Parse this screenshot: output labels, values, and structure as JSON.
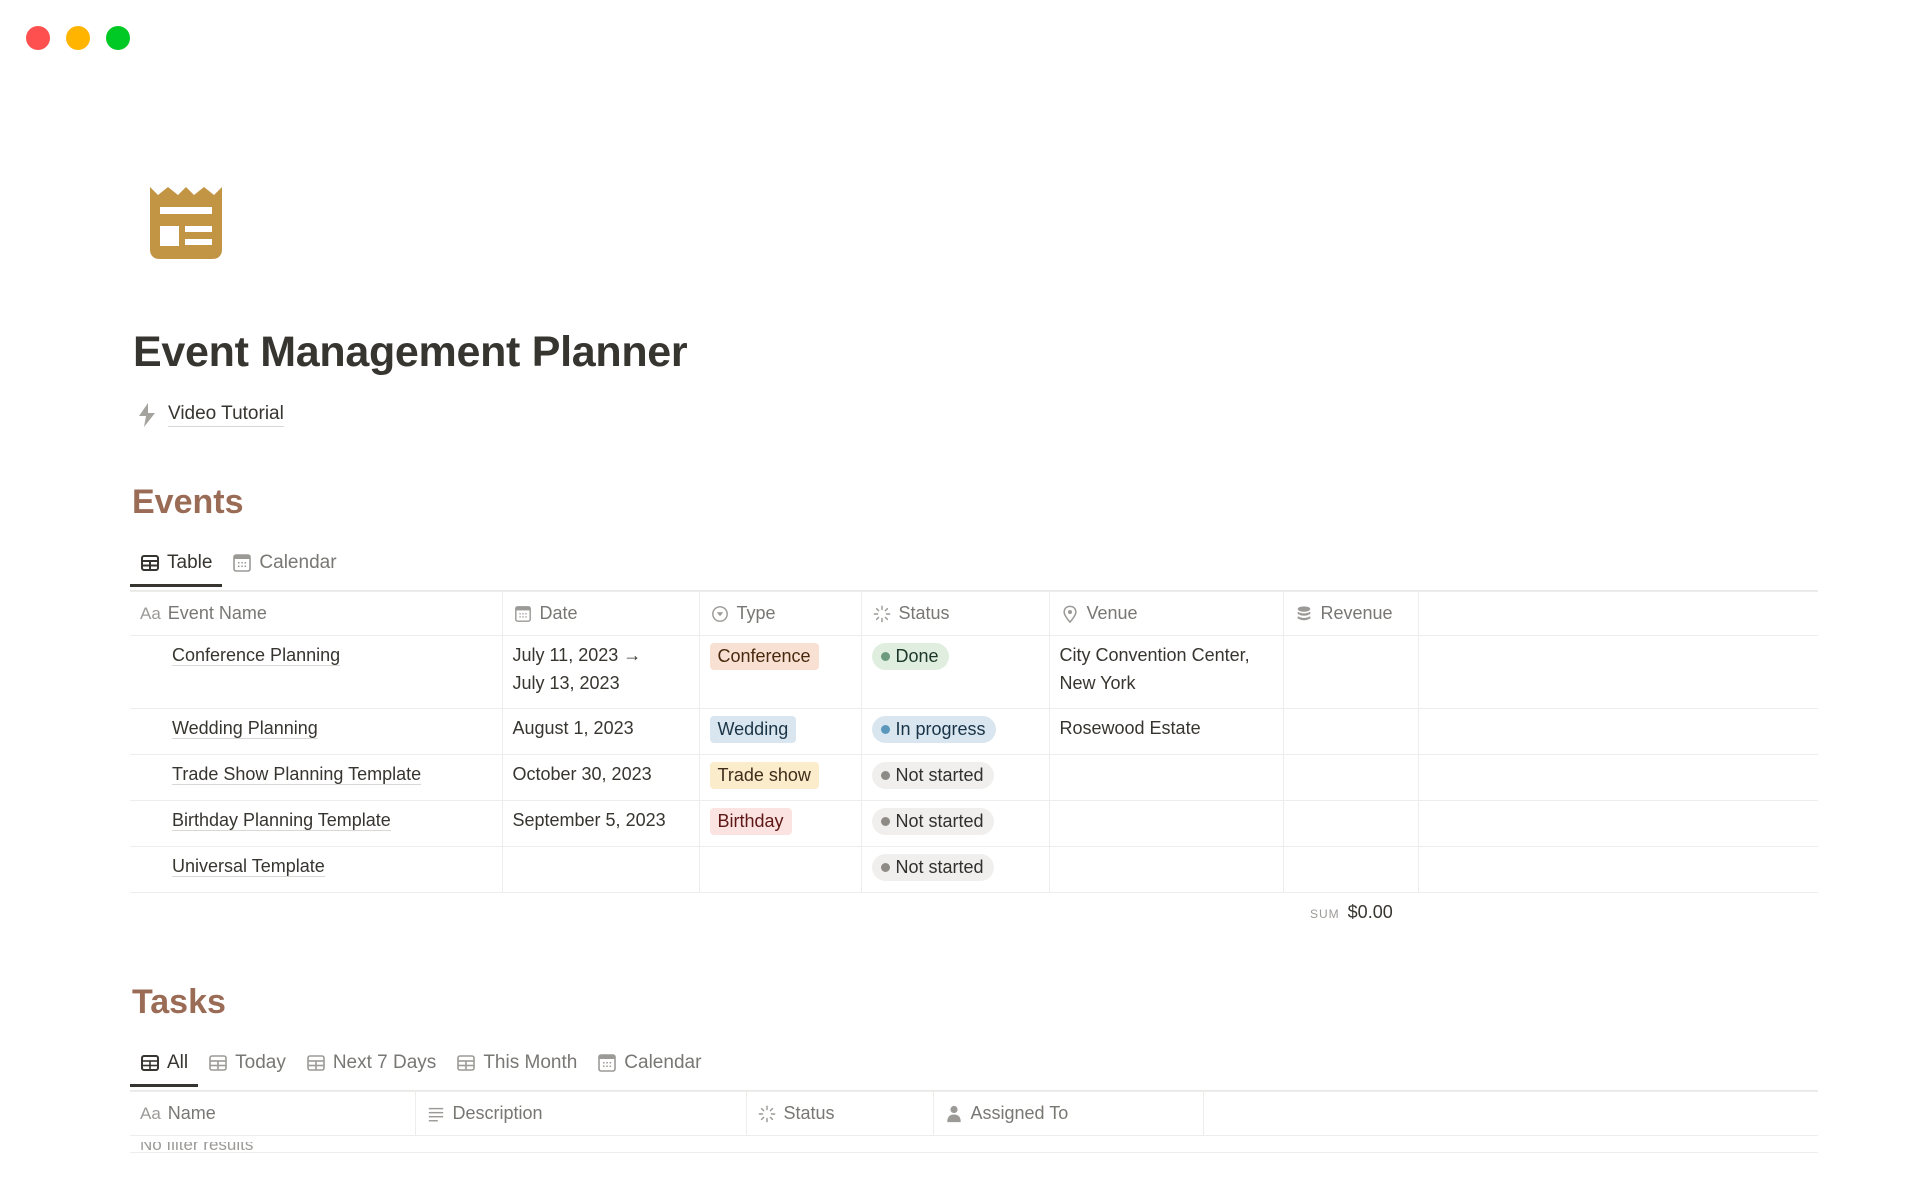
{
  "window": {
    "controls": [
      "close",
      "minimize",
      "maximize"
    ],
    "colors": {
      "close": "#ff5050",
      "minimize": "#ffb400",
      "maximize": "#00c824"
    }
  },
  "page": {
    "icon": "newspaper-icon",
    "icon_color": "#c29545",
    "title": "Event Management Planner",
    "links": [
      {
        "icon": "bolt-icon",
        "label": "Video Tutorial"
      }
    ]
  },
  "events": {
    "heading": "Events",
    "heading_color": "#9a6b55",
    "tabs": [
      {
        "label": "Table",
        "icon": "table-icon",
        "active": true
      },
      {
        "label": "Calendar",
        "icon": "calendar-icon",
        "active": false
      }
    ],
    "columns": [
      {
        "label": "Event Name",
        "icon": "text-aa-icon",
        "icon_text": "Aa"
      },
      {
        "label": "Date",
        "icon": "calendar-icon"
      },
      {
        "label": "Type",
        "icon": "select-icon"
      },
      {
        "label": "Status",
        "icon": "status-spinner-icon"
      },
      {
        "label": "Venue",
        "icon": "location-pin-icon"
      },
      {
        "label": "Revenue",
        "icon": "coins-stack-icon"
      }
    ],
    "rows": [
      {
        "name": "Conference Planning",
        "date_line1": "July 11, 2023 →",
        "date_line2": "July 13, 2023",
        "type": "Conference",
        "type_bg": "#f8e1d3",
        "type_fg": "#49290e",
        "status": "Done",
        "status_key": "done",
        "venue_line1": "City Convention Center,",
        "venue_line2": "New York",
        "revenue": ""
      },
      {
        "name": "Wedding Planning",
        "date_line1": "August 1, 2023",
        "date_line2": "",
        "type": "Wedding",
        "type_bg": "#d9e6ef",
        "type_fg": "#1b3547",
        "status": "In progress",
        "status_key": "in-progress",
        "venue_line1": "Rosewood Estate",
        "venue_line2": "",
        "revenue": ""
      },
      {
        "name": "Trade Show Planning Template",
        "date_line1": "October 30, 2023",
        "date_line2": "",
        "type": "Trade show",
        "type_bg": "#fbeccb",
        "type_fg": "#402c1b",
        "status": "Not started",
        "status_key": "not-started",
        "venue_line1": "",
        "venue_line2": "",
        "revenue": ""
      },
      {
        "name": "Birthday Planning Template",
        "date_line1": "September 5, 2023",
        "date_line2": "",
        "type": "Birthday",
        "type_bg": "#fbe3e1",
        "type_fg": "#5d1715",
        "status": "Not started",
        "status_key": "not-started",
        "venue_line1": "",
        "venue_line2": "",
        "revenue": ""
      },
      {
        "name": "Universal Template",
        "date_line1": "",
        "date_line2": "",
        "type": "",
        "type_bg": "",
        "type_fg": "",
        "status": "Not started",
        "status_key": "not-started",
        "venue_line1": "",
        "venue_line2": "",
        "revenue": ""
      }
    ],
    "status_styles": {
      "done": {
        "bg": "#e0eee0",
        "dot": "#6c9b7d",
        "fg": "#1c3829"
      },
      "in-progress": {
        "bg": "#d9e6ef",
        "dot": "#5b97bd",
        "fg": "#183347"
      },
      "not-started": {
        "bg": "#f0efed",
        "dot": "#8e8b86",
        "fg": "#32302c"
      }
    },
    "footer": {
      "sum_label": "SUM",
      "sum_value": "$0.00"
    }
  },
  "tasks": {
    "heading": "Tasks",
    "tabs": [
      {
        "label": "All",
        "icon": "table-icon",
        "active": true
      },
      {
        "label": "Today",
        "icon": "table-icon",
        "active": false
      },
      {
        "label": "Next 7 Days",
        "icon": "table-icon",
        "active": false
      },
      {
        "label": "This Month",
        "icon": "table-icon",
        "active": false
      },
      {
        "label": "Calendar",
        "icon": "calendar-icon",
        "active": false
      }
    ],
    "columns": [
      {
        "label": "Name",
        "icon": "text-aa-icon",
        "icon_text": "Aa"
      },
      {
        "label": "Description",
        "icon": "text-lines-icon"
      },
      {
        "label": "Status",
        "icon": "status-spinner-icon"
      },
      {
        "label": "Assigned To",
        "icon": "person-icon"
      }
    ],
    "empty_message": "No filter results"
  }
}
